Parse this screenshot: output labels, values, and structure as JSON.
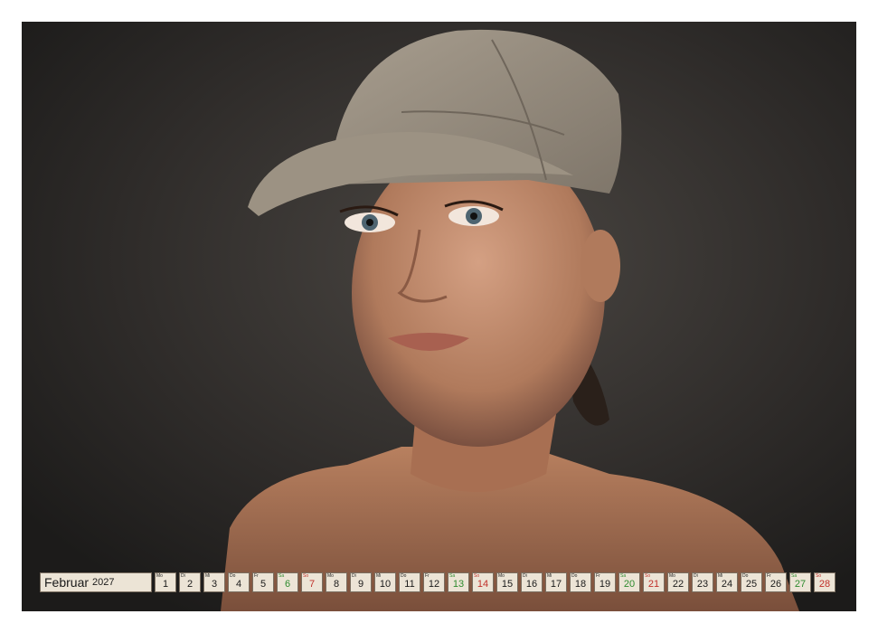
{
  "calendar": {
    "month": "Februar",
    "year": "2027",
    "days": [
      {
        "wd": "Mo",
        "num": "1",
        "type": "weekday"
      },
      {
        "wd": "Di",
        "num": "2",
        "type": "weekday"
      },
      {
        "wd": "Mi",
        "num": "3",
        "type": "weekday"
      },
      {
        "wd": "Do",
        "num": "4",
        "type": "weekday"
      },
      {
        "wd": "Fr",
        "num": "5",
        "type": "weekday"
      },
      {
        "wd": "Sa",
        "num": "6",
        "type": "sat"
      },
      {
        "wd": "So",
        "num": "7",
        "type": "sun"
      },
      {
        "wd": "Mo",
        "num": "8",
        "type": "weekday"
      },
      {
        "wd": "Di",
        "num": "9",
        "type": "weekday"
      },
      {
        "wd": "Mi",
        "num": "10",
        "type": "weekday"
      },
      {
        "wd": "Do",
        "num": "11",
        "type": "weekday"
      },
      {
        "wd": "Fr",
        "num": "12",
        "type": "weekday"
      },
      {
        "wd": "Sa",
        "num": "13",
        "type": "sat"
      },
      {
        "wd": "So",
        "num": "14",
        "type": "sun"
      },
      {
        "wd": "Mo",
        "num": "15",
        "type": "weekday"
      },
      {
        "wd": "Di",
        "num": "16",
        "type": "weekday"
      },
      {
        "wd": "Mi",
        "num": "17",
        "type": "weekday"
      },
      {
        "wd": "Do",
        "num": "18",
        "type": "weekday"
      },
      {
        "wd": "Fr",
        "num": "19",
        "type": "weekday"
      },
      {
        "wd": "Sa",
        "num": "20",
        "type": "sat"
      },
      {
        "wd": "So",
        "num": "21",
        "type": "sun"
      },
      {
        "wd": "Mo",
        "num": "22",
        "type": "weekday"
      },
      {
        "wd": "Di",
        "num": "23",
        "type": "weekday"
      },
      {
        "wd": "Mi",
        "num": "24",
        "type": "weekday"
      },
      {
        "wd": "Do",
        "num": "25",
        "type": "weekday"
      },
      {
        "wd": "Fr",
        "num": "26",
        "type": "weekday"
      },
      {
        "wd": "Sa",
        "num": "27",
        "type": "sat"
      },
      {
        "wd": "So",
        "num": "28",
        "type": "sun"
      }
    ]
  },
  "colors": {
    "saturday": "#2e8b2e",
    "sunday": "#c0302a",
    "strip_background": "#ece4d6",
    "photo_background": "#2c2a29"
  },
  "icons": {
    "binding": "spiral-binding-icon",
    "hanger": "hanger-hole-icon"
  }
}
